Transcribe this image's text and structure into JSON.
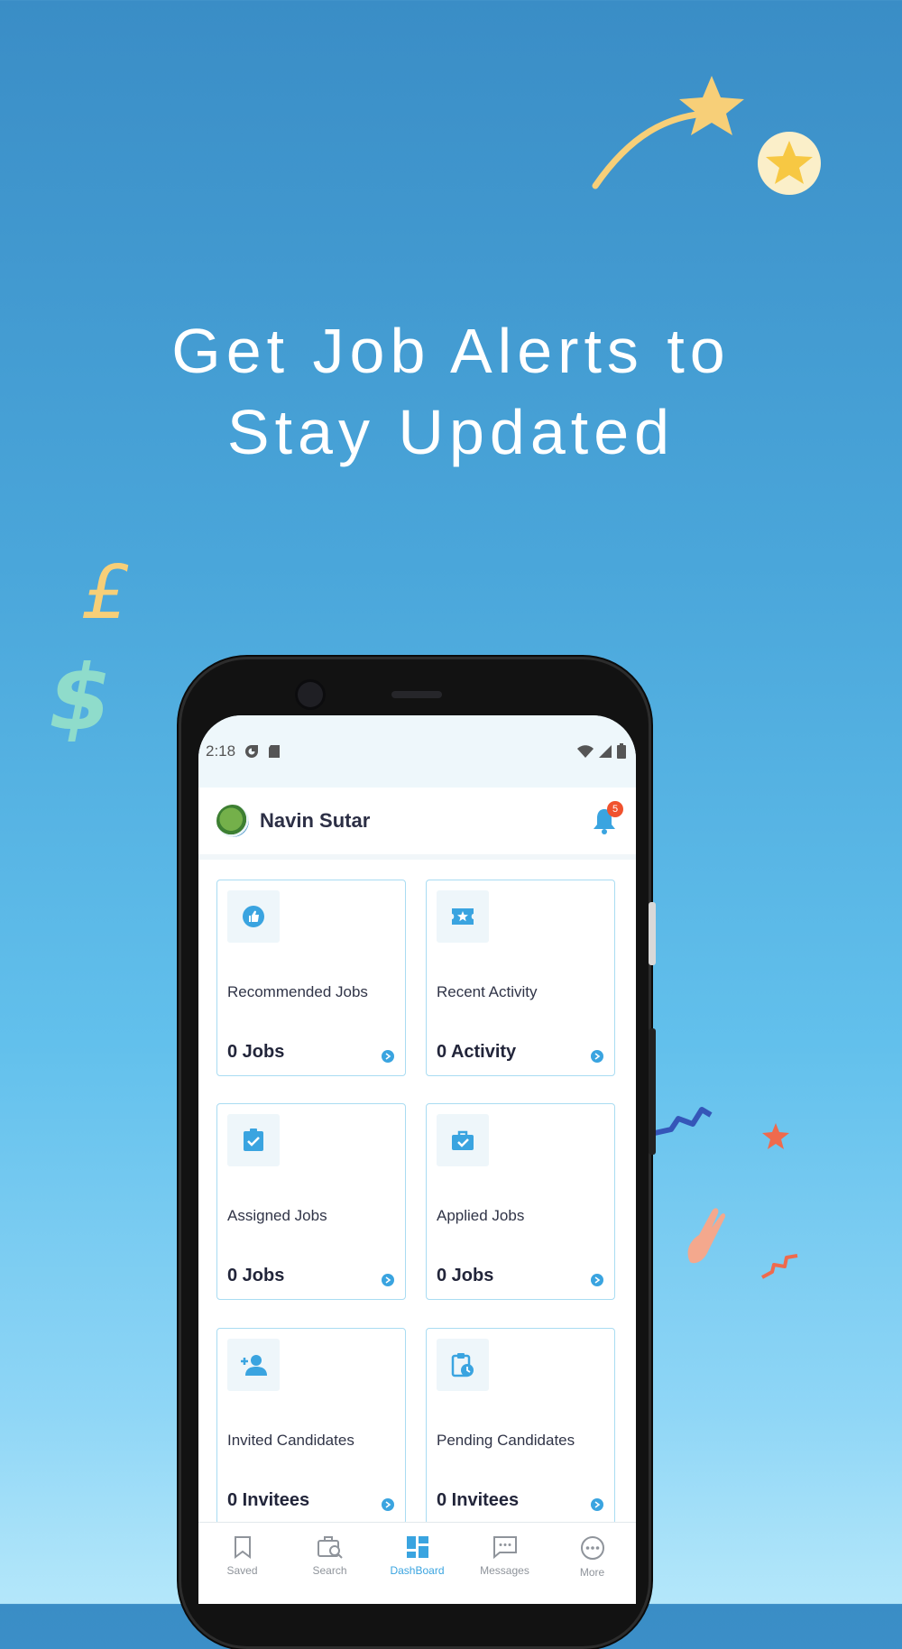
{
  "headline": {
    "line1": "Get Job Alerts to",
    "line2": "Stay Updated"
  },
  "colors": {
    "accent": "#3aa4e0",
    "badge": "#f0522e",
    "card_border": "#a9dcf2",
    "star": "#f7cf78"
  },
  "status_bar": {
    "time": "2:18",
    "icons": [
      "media-icon",
      "sd-card-icon",
      "wifi-icon",
      "signal-icon",
      "battery-icon"
    ]
  },
  "app_header": {
    "user_name": "Navin Sutar",
    "notification_count": "5"
  },
  "cards": [
    {
      "title": "Recommended Jobs",
      "value": "0 Jobs",
      "icon": "thumbs-up-icon"
    },
    {
      "title": "Recent Activity",
      "value": "0 Activity",
      "icon": "ticket-star-icon"
    },
    {
      "title": "Assigned Jobs",
      "value": "0 Jobs",
      "icon": "clipboard-check-icon"
    },
    {
      "title": "Applied Jobs",
      "value": "0 Jobs",
      "icon": "briefcase-check-icon"
    },
    {
      "title": "Invited Candidates",
      "value": "0 Invitees",
      "icon": "person-add-icon"
    },
    {
      "title": "Pending Candidates",
      "value": "0 Invitees",
      "icon": "clipboard-clock-icon"
    }
  ],
  "bottom_nav": {
    "items": [
      {
        "label": "Saved",
        "icon": "bookmark-icon"
      },
      {
        "label": "Search",
        "icon": "briefcase-search-icon"
      },
      {
        "label": "DashBoard",
        "icon": "dashboard-icon"
      },
      {
        "label": "Messages",
        "icon": "chat-icon"
      },
      {
        "label": "More",
        "icon": "more-icon"
      }
    ],
    "active": "DashBoard"
  }
}
